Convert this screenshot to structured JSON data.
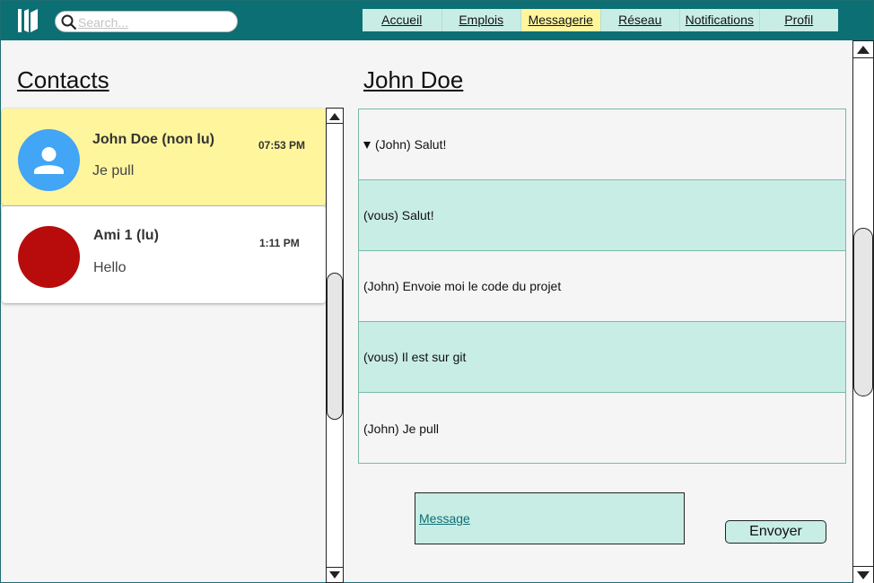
{
  "header": {
    "search": {
      "placeholder": "Search..."
    },
    "nav": [
      {
        "label": "Accueil",
        "active": false
      },
      {
        "label": "Emplois",
        "active": false
      },
      {
        "label": "Messagerie",
        "active": true
      },
      {
        "label": "Réseau",
        "active": false
      },
      {
        "label": "Notifications",
        "active": false
      },
      {
        "label": "Profil",
        "active": false
      }
    ]
  },
  "contacts": {
    "title": "Contacts",
    "items": [
      {
        "name": "John Doe (non lu)",
        "time": "07:53 PM",
        "preview": "Je pull",
        "avatar": "person-icon"
      },
      {
        "name": "Ami 1 (lu)",
        "time": "1:11 PM",
        "preview": "Hello",
        "avatar": "red-circle"
      }
    ]
  },
  "chat": {
    "title": "John Doe",
    "messages": [
      {
        "text": "(John) Salut!",
        "expanded": true
      },
      {
        "text": "(vous) Salut!"
      },
      {
        "text": "(John) Envoie moi le code du projet"
      },
      {
        "text": "(vous) Il est sur git"
      },
      {
        "text": "(John) Je pull"
      }
    ],
    "compose": {
      "placeholder": "Message"
    },
    "send_label": "Envoyer"
  },
  "colors": {
    "topbar": "#0b6f74",
    "accent_light": "#c8ede5",
    "highlight": "#fff59d",
    "avatar_blue": "#42a5f5",
    "avatar_red": "#b80c0c"
  }
}
